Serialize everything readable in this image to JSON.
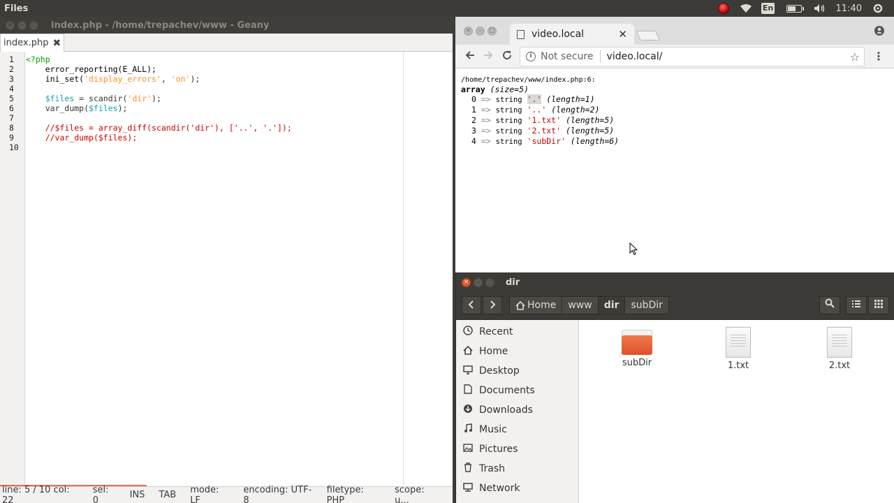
{
  "top_panel": {
    "app_title": "Files",
    "keyboard": "En",
    "time": "11:40",
    "battery_level": 0.7
  },
  "geany": {
    "window_title": "index.php - /home/trepachev/www - Geany",
    "tab_label": "index.php",
    "tab_close": "✖",
    "line_numbers": [
      "1",
      "2",
      "3",
      "4",
      "5",
      "6",
      "7",
      "8",
      "9",
      "10"
    ],
    "status": {
      "position": "line: 5 / 10  col: 22",
      "sel": "sel: 0",
      "ins": "INS",
      "tab": "TAB",
      "mode": "mode: LF",
      "encoding": "encoding: UTF-8",
      "filetype": "filetype: PHP",
      "scope": "scope: u..."
    }
  },
  "code": {
    "l1_tag": "<?php",
    "l2_fn": "error_reporting(E_ALL);",
    "l3_fn": "ini_set(",
    "l3_s1": "'display_errors'",
    "l3_sep": ", ",
    "l3_s2": "'on'",
    "l3_end": ");",
    "l5_var": "$files",
    "l5_mid": " = scandir(",
    "l5_str": "'dir'",
    "l5_end": ");",
    "l6_fn": "var_dump(",
    "l6_var": "$files",
    "l6_end": ");",
    "l8_cmt": "//$files = array_diff(scandir('dir'), ['..', '.']);",
    "l9_cmt": "//var_dump($files);"
  },
  "chrome": {
    "tab_title": "video.local",
    "tab_close": "✕",
    "not_secure": "Not secure",
    "url": "video.local/",
    "dump": {
      "path": "/home/trepachev/www/index.php:6:",
      "array_kw": "array",
      "size": "(size=5)",
      "rows": [
        {
          "idx": "0",
          "val": "'.'",
          "len": "(length=1)"
        },
        {
          "idx": "1",
          "val": "'..'",
          "len": "(length=2)"
        },
        {
          "idx": "2",
          "val": "'1.txt'",
          "len": "(length=5)"
        },
        {
          "idx": "3",
          "val": "'2.txt'",
          "len": "(length=5)"
        },
        {
          "idx": "4",
          "val": "'subDir'",
          "len": "(length=6)"
        }
      ],
      "arrow": "=>",
      "string_kw": "string"
    }
  },
  "files": {
    "window_title": "dir",
    "crumbs": [
      "Home",
      "www",
      "dir",
      "subDir"
    ],
    "sidebar": [
      {
        "label": "Recent",
        "icon": "clock-icon"
      },
      {
        "label": "Home",
        "icon": "home-icon"
      },
      {
        "label": "Desktop",
        "icon": "desktop-icon"
      },
      {
        "label": "Documents",
        "icon": "documents-icon"
      },
      {
        "label": "Downloads",
        "icon": "downloads-icon"
      },
      {
        "label": "Music",
        "icon": "music-icon"
      },
      {
        "label": "Pictures",
        "icon": "pictures-icon"
      },
      {
        "label": "Trash",
        "icon": "trash-icon"
      },
      {
        "label": "Network",
        "icon": "network-icon"
      }
    ],
    "items": [
      {
        "label": "subDir",
        "kind": "folder"
      },
      {
        "label": "1.txt",
        "kind": "text"
      },
      {
        "label": "2.txt",
        "kind": "text"
      }
    ]
  }
}
